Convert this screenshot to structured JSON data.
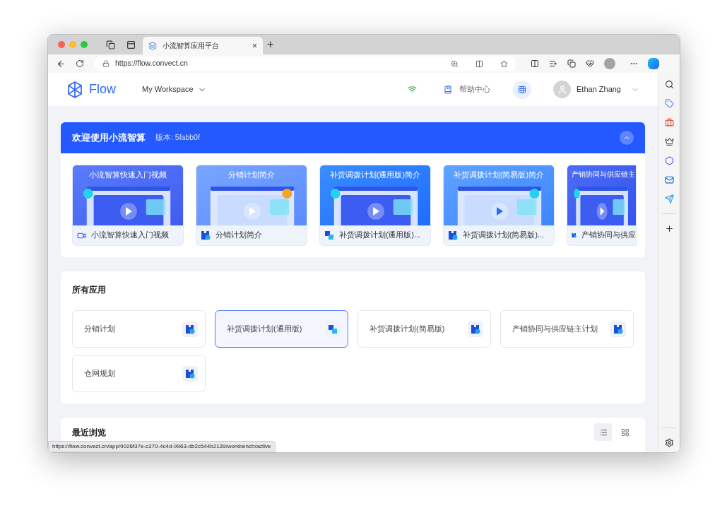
{
  "browser": {
    "tab": {
      "title": "小流智算应用平台",
      "close": "×"
    },
    "new_tab": "+",
    "address": "https://flow.convect.cn"
  },
  "header": {
    "brand": "Flow",
    "workspace": "My Workspace",
    "help": "帮助中心",
    "user": "Ethan Zhang"
  },
  "banner": {
    "title": "欢迎使用小流智算",
    "version": "版本: 5fabb0f",
    "expanded": true,
    "cards": [
      {
        "title": "小流智算快速入门视频",
        "caption": "小流智算快速入门视频"
      },
      {
        "title": "分销计划简介",
        "caption": "分销计划简介"
      },
      {
        "title": "补货调拨计划(通用版)简介",
        "caption": "补货调拨计划(通用版)..."
      },
      {
        "title": "补货调拨计划(简易版)简介",
        "caption": "补货调拨计划(简易版)..."
      },
      {
        "title": "产销协同与供应链主",
        "caption": "产销协同与供应"
      }
    ]
  },
  "apps": {
    "title": "所有应用",
    "items": [
      {
        "name": "分销计划",
        "selected": false
      },
      {
        "name": "补货调拨计划(通用版)",
        "selected": true
      },
      {
        "name": "补货调拨计划(简易版)",
        "selected": false
      },
      {
        "name": "产销协同与供应链主计划",
        "selected": false
      },
      {
        "name": "仓网规划",
        "selected": false
      }
    ]
  },
  "recent": {
    "title": "最近浏览",
    "views": [
      {
        "kind": "list",
        "selected": true
      },
      {
        "kind": "grid",
        "selected": false
      }
    ]
  },
  "status_bar": "https://flow.convect.cn/app/9026f37e-c370-4c4d-9963-db2c544b2139/workbench/active"
}
